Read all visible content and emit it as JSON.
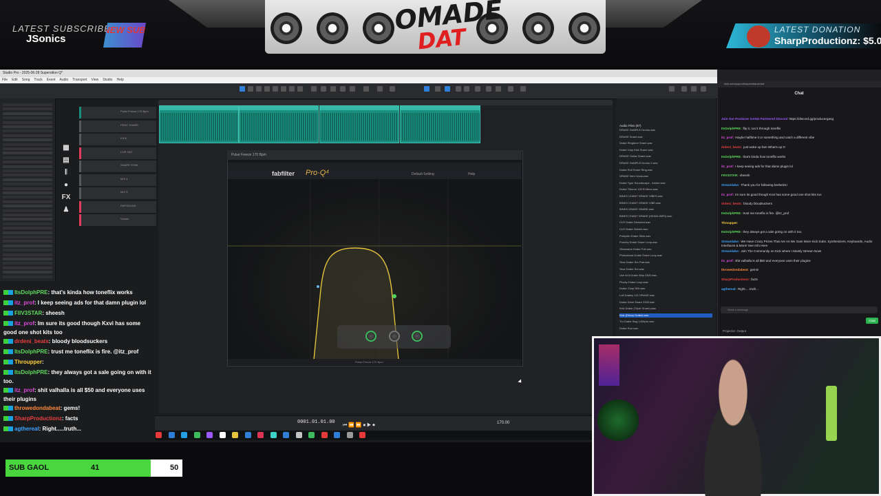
{
  "overlay": {
    "latest_subscriber_label": "LATEST SUBSCRIBER",
    "latest_subscriber_name": "JSonics",
    "new_sub_badge": "NEW SUB",
    "logo_top": "OMADE",
    "logo_bottom": "DAT",
    "latest_donation_label": "LATEST DONATION",
    "latest_donation_value": "SharpProductionz: $5.0"
  },
  "daw": {
    "title": "Studio Pro - 2025-06-28 Supersition Q*",
    "menu": [
      "File",
      "Edit",
      "Song",
      "Track",
      "Event",
      "Audio",
      "Transport",
      "View",
      "Studio",
      "Help"
    ],
    "tracks": [
      {
        "name": "Pulse Freeze 170 Bpm",
        "color": "#1a8f7f"
      },
      {
        "name": "PERC SHARE",
        "color": "#555a60"
      },
      {
        "name": "KICK",
        "color": "#555a60"
      },
      {
        "name": "LIVE HAT",
        "color": "#e23d5f"
      },
      {
        "name": "SNARE STAB",
        "color": "#555a60"
      },
      {
        "name": "MIX 4",
        "color": "#555a60"
      },
      {
        "name": "MIX 5",
        "color": "#555a60"
      },
      {
        "name": "RAPSOUND",
        "color": "#e23d5f"
      },
      {
        "name": "Vocals",
        "color": "#e23d5f"
      }
    ],
    "clip_label": "Pulse Freeze 170 Bpm",
    "icon_fx": "FX",
    "time_display": "0001.01.01.00",
    "bpm": "170.00"
  },
  "proq": {
    "window_title": "Pulse Freeze 170 Bpm",
    "brand": "fabfilter",
    "product": "Pro·Q⁴",
    "preset": "Default Setting",
    "help": "Help",
    "foot": "Pulse Freeze 170 Bpm"
  },
  "browser": {
    "title": "Audio Files (87)",
    "items": [
      "DRAKE SAMPLE Drums.wav",
      "DRAKE Snare.wav",
      "Drake Ringtone Snare.wav",
      "Drake Clap Kick Snare.wav",
      "DRAKE Guitar Snare.wav",
      "DRAKE SAMPLE Drums 2.wav",
      "Drake Roll Snare Ring.wav",
      "DRAKE Intro Vocal.wav",
      "Drake Type Soundscape - Amber.wav",
      "Drake Tiburon 120 B Minor.wav",
      "BINKS CHANT DRAKE VIBES.wav",
      "BINKS CHANT DRAKE VIBE.wav",
      "BINKS DRAKE SNARE.wav",
      "BINKS CHANT DRAKE (HEADLINES).wav",
      "CLR Drake Distorted.wav",
      "CLR Drake Sketch.wav",
      "Pumpkin Drake Stick.wav",
      "Punchy Drake Snare Loop.wav",
      "Obsession Drake Full.wav",
      "Photoshoot Drake Snare Loop.wav",
      "Slow Drake Snr Pad.wav",
      "Slow Drake Snr.wav",
      "Use At A Drake Way 2300.wav",
      "Plucky Drake Loop.wav",
      "Drake Chop 500.wav",
      "Lofi Drakey 121 DRAKE.wav",
      "Drake Drive Snare 2300.wav",
      "Kick Drake (Triple Snare).wav",
      "Kick (Drizzy Drake).wav",
      "Tru Drake Swg 140bpm.wav",
      "Drake Run.wav"
    ],
    "selected_index": 28
  },
  "chat_window": {
    "url": "kick.com/popout/supersitara/chat",
    "title": "Chat",
    "lines": [
      {
        "user": "Join Our Producer GANG Partnered Discord",
        "text": "https://discord.gg/producergang",
        "color": "#9b59ff"
      },
      {
        "user": "ItsDolphPRE:",
        "text": "flip it, run it through toneflix",
        "color": "#5fdc5f"
      },
      {
        "user": "itz_prof:",
        "text": "maybe halftime it or something and catch a different vibe",
        "color": "#d94bd9"
      },
      {
        "user": "drdeni_beats:",
        "text": "just woke up fam What's up O",
        "color": "#e84040"
      },
      {
        "user": "ItsDolphPRE:",
        "text": "that's kinda how toneflix works",
        "color": "#5fdc5f"
      },
      {
        "user": "itz_prof:",
        "text": "I keep seeing ads for that damn plugin lol",
        "color": "#d94bd9"
      },
      {
        "user": "FIIV3STAR:",
        "text": "sheesh",
        "color": "#5fdc5f"
      },
      {
        "user": "Streamlabs:",
        "text": "Thank you for following berbel21!",
        "color": "#3da5ff"
      },
      {
        "user": "itz_prof:",
        "text": "Im sure its good though Kxvi has some good one shot kits too",
        "color": "#d94bd9"
      },
      {
        "user": "drdeni_beats:",
        "text": "bloody bloodsuckers",
        "color": "#e84040"
      },
      {
        "user": "ItsDolphPRE:",
        "text": "trust me toneflix is fire. @itz_prof",
        "color": "#5fdc5f"
      },
      {
        "user": "Throupper:",
        "text": "",
        "color": "#ffd23d"
      },
      {
        "user": "ItsDolphPRE:",
        "text": "they always got a sale going on with it too.",
        "color": "#5fdc5f"
      },
      {
        "user": "Streamlabs:",
        "text": "We Have Crazy Prizes That Are As We Gain More Kick Subs. Synthesizers, Keyboards, Audio Interfaces & More! See Info Here",
        "color": "#3da5ff"
      },
      {
        "user": "Streamlabs:",
        "text": "Join The Community on Kick where I Mainly Stream Now!",
        "color": "#3da5ff"
      },
      {
        "user": "itz_prof:",
        "text": "shit valhalla is all $50 and everyone uses their plugins",
        "color": "#d94bd9"
      },
      {
        "user": "throwedondabeat:",
        "text": "gems!",
        "color": "#ff8a3d"
      },
      {
        "user": "SharpProductionz:",
        "text": "facts",
        "color": "#e84040"
      },
      {
        "user": "agthereal:",
        "text": "Right.....truth...",
        "color": "#3da5ff"
      }
    ],
    "input_placeholder": "Send a message",
    "send_label": "Chat",
    "projector_label": "Projector: Output"
  },
  "overlay_chat": [
    {
      "user": "ItsDolphPRE",
      "text": ": that's kinda how toneflix works",
      "cls": "u-g"
    },
    {
      "user": "itz_prof",
      "text": ": I keep seeing ads for that damn plugin lol",
      "cls": "u-p"
    },
    {
      "user": "FIIV3STAR",
      "text": ": sheesh",
      "cls": "u-g"
    },
    {
      "user": "itz_prof",
      "text": ": Im sure its good though Kxvi has some good one shot kits too",
      "cls": "u-p"
    },
    {
      "user": "drdeni_beats",
      "text": ": bloody bloodsuckers",
      "cls": "u-r"
    },
    {
      "user": "ItsDolphPRE",
      "text": ": trust me toneflix is fire. @itz_prof",
      "cls": "u-g"
    },
    {
      "user": "Throupper",
      "text": ":",
      "cls": "u-y"
    },
    {
      "user": "ItsDolphPRE",
      "text": ": they always got a sale going on with it too.",
      "cls": "u-g"
    },
    {
      "user": "itz_prof",
      "text": ": shit valhalla is all $50 and everyone uses their plugins",
      "cls": "u-p"
    },
    {
      "user": "throwedondabeat",
      "text": ": gems!",
      "cls": "u-o"
    },
    {
      "user": "SharpProductionz",
      "text": ": facts",
      "cls": "u-r"
    },
    {
      "user": "agthereal",
      "text": ": Right.....truth...",
      "cls": "u-b"
    }
  ],
  "sub_goal": {
    "label": "SUB GAOL",
    "current": "41",
    "target": "50",
    "progress_fraction": 0.82,
    "fill_color": "#49d63f"
  }
}
